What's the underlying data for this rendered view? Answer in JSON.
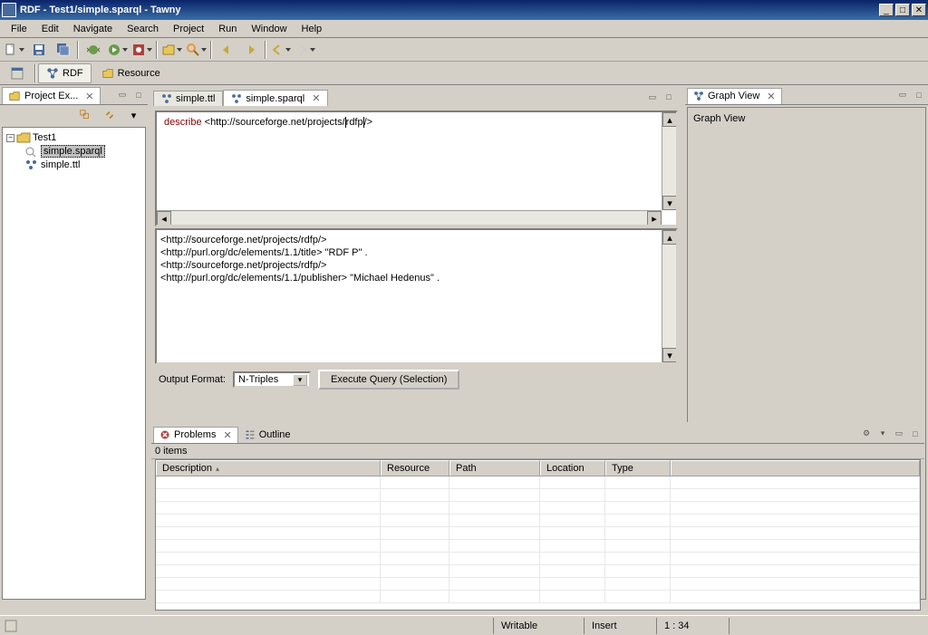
{
  "window": {
    "title": "RDF - Test1/simple.sparql - Tawny"
  },
  "menubar": [
    "File",
    "Edit",
    "Navigate",
    "Search",
    "Project",
    "Run",
    "Window",
    "Help"
  ],
  "perspectives": {
    "rdf": "RDF",
    "resource": "Resource"
  },
  "projectExplorer": {
    "title": "Project Ex...",
    "root": "Test1",
    "children": [
      "simple.sparql",
      "simple.ttl"
    ]
  },
  "editor": {
    "tabs": [
      "simple.ttl",
      "simple.sparql"
    ],
    "activeTab": 1,
    "queryPrefix": "describe",
    "queryUri": "<http://sourceforge.net/projects/",
    "queryCaretWord": "rdfp",
    "querySuffix": "/>",
    "results": "<http://sourceforge.net/projects/rdfp/>\n<http://purl.org/dc/elements/1.1/title> \"RDF P\" .\n<http://sourceforge.net/projects/rdfp/>\n<http://purl.org/dc/elements/1.1/publisher> \"Michael Hedenus\" .",
    "outputFormatLabel": "Output Format:",
    "outputFormat": "N-Triples",
    "executeLabel": "Execute Query (Selection)"
  },
  "graphView": {
    "title": "Graph View",
    "body": "Graph View"
  },
  "bottom": {
    "problemsTab": "Problems",
    "outlineTab": "Outline",
    "itemCount": "0 items",
    "columns": {
      "description": "Description",
      "resource": "Resource",
      "path": "Path",
      "location": "Location",
      "type": "Type"
    }
  },
  "statusbar": {
    "writable": "Writable",
    "mode": "Insert",
    "position": "1 : 34"
  }
}
